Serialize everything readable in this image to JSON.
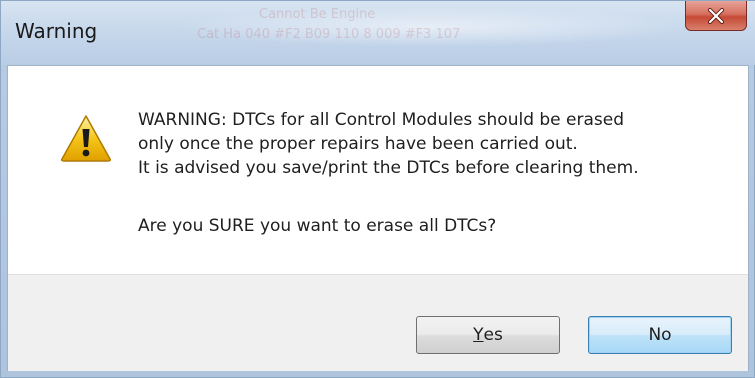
{
  "window": {
    "title": "Warning",
    "background_text_1": "Cannot Be Engine",
    "background_text_2": "Cat Ha 040 #F2 B09 110 8   009 #F3 107"
  },
  "dialog": {
    "icon": "warning-triangle-icon",
    "message_lines": [
      "WARNING: DTCs for all Control Modules should be erased",
      "only once the proper repairs have been carried out.",
      "It is advised you save/print the DTCs before clearing them."
    ],
    "question": "Are you SURE you want to erase all DTCs?"
  },
  "buttons": {
    "yes_mnemonic": "Y",
    "yes_rest": "es",
    "no_label": "No"
  },
  "colors": {
    "warning_yellow": "#f5c518",
    "default_button_border": "#3c7fb1",
    "close_button_red": "#c54a35"
  }
}
